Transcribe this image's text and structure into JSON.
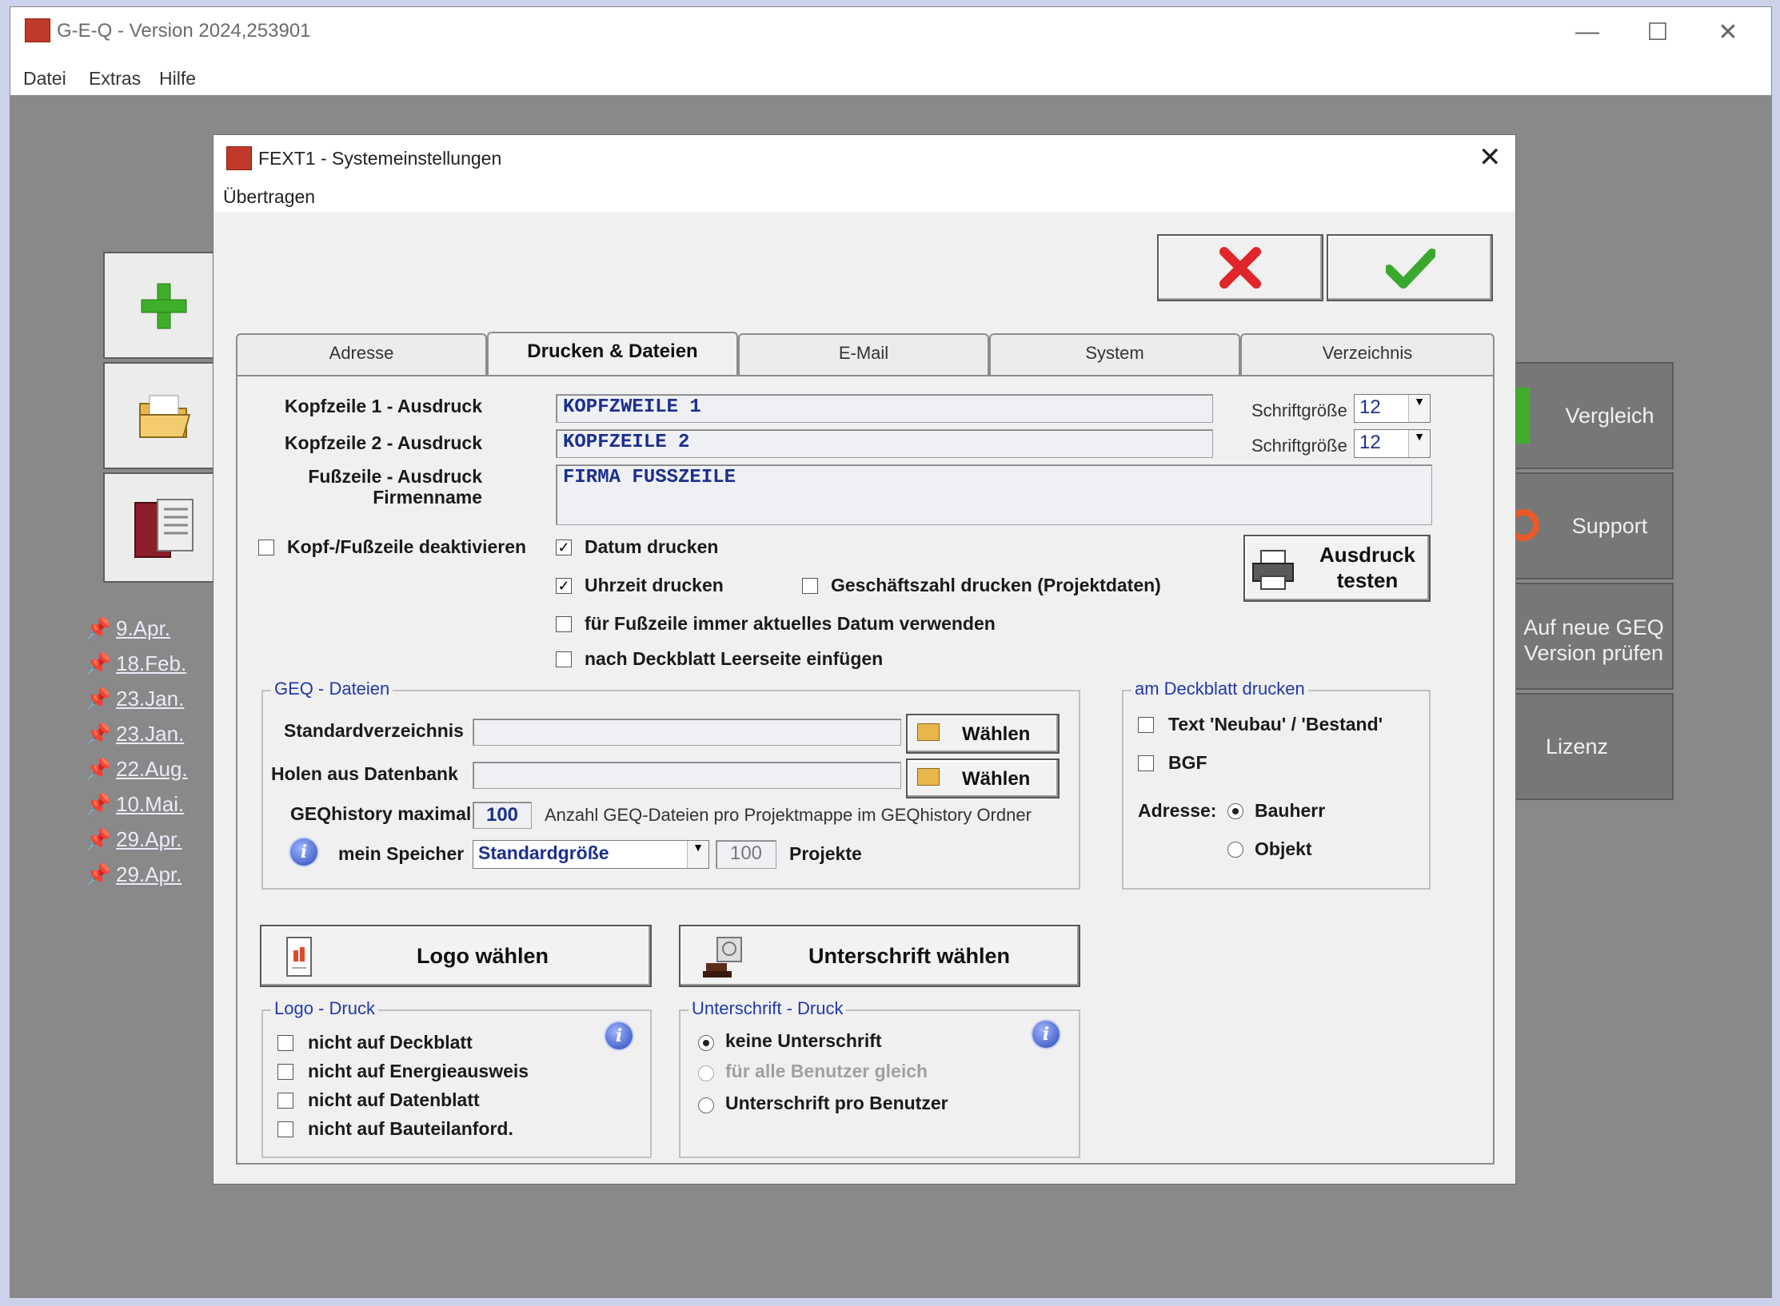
{
  "app": {
    "title": "G-E-Q - Version 2024,253901",
    "menu": [
      "Datei",
      "Extras",
      "Hilfe"
    ],
    "window_controls": [
      "minimize-icon",
      "maximize-icon",
      "close-icon"
    ]
  },
  "background": {
    "side_buttons": [
      "add-icon",
      "folder-icon",
      "book-icon"
    ],
    "recent": [
      "9.Apr.",
      "18.Feb.",
      "23.Jan.",
      "23.Jan.",
      "22.Aug.",
      "10.Mai.",
      "29.Apr.",
      "29.Apr."
    ],
    "right_buttons": [
      "Vergleich",
      "Support",
      "Auf neue GEQ Version prüfen",
      "Lizenz"
    ]
  },
  "dialog": {
    "title": "FEXT1 - Systemeinstellungen",
    "menu": "Übertragen",
    "tabs": [
      "Adresse",
      "Drucken & Dateien",
      "E-Mail",
      "System",
      "Verzeichnis"
    ],
    "active_tab": "Drucken & Dateien",
    "header": {
      "kopf1_label": "Kopfzeile 1 - Ausdruck",
      "kopf1_value": "KOPFZWEILE 1",
      "kopf2_label": "Kopfzeile 2 - Ausdruck",
      "kopf2_value": "KOPFZEILE 2",
      "fuss_label_1": "Fußzeile - Ausdruck",
      "fuss_label_2": "Firmenname",
      "fuss_value": "FIRMA FUSSZEILE",
      "size_label": "Schriftgröße",
      "size1": "12",
      "size2": "12"
    },
    "checks": {
      "deactivate": "Kopf-/Fußzeile deaktivieren",
      "datum": "Datum drucken",
      "uhrzeit": "Uhrzeit drucken",
      "geschaeftszahl": "Geschäftszahl drucken (Projektdaten)",
      "aktuelles_datum": "für Fußzeile immer aktuelles Datum verwenden",
      "leerseite": "nach Deckblatt Leerseite einfügen",
      "check_mark": "✓"
    },
    "print_test": {
      "line1": "Ausdruck",
      "line2": "testen"
    },
    "geq_files": {
      "title": "GEQ - Dateien",
      "std_label": "Standardverzeichnis",
      "holen_label": "Holen aus Datenbank",
      "choose": "Wählen",
      "history_label": "GEQhistory maximal",
      "history_value": "100",
      "history_desc": "Anzahl GEQ-Dateien pro Projektmappe im GEQhistory Ordner",
      "speicher_label": "mein Speicher",
      "speicher_value": "Standardgröße",
      "projects_value": "100",
      "projects_label": "Projekte"
    },
    "deckblatt": {
      "title": "am Deckblatt drucken",
      "text_neubau": "Text 'Neubau' / 'Bestand'",
      "bgf": "BGF",
      "adresse_label": "Adresse:",
      "bauherr": "Bauherr",
      "objekt": "Objekt"
    },
    "logo_button": "Logo wählen",
    "signature_button": "Unterschrift wählen",
    "logo_print": {
      "title": "Logo - Druck",
      "items": [
        "nicht auf Deckblatt",
        "nicht auf Energieausweis",
        "nicht auf Datenblatt",
        "nicht auf Bauteilanford."
      ]
    },
    "signature_print": {
      "title": "Unterschrift - Druck",
      "keine": "keine Unterschrift",
      "alle": "für alle Benutzer gleich",
      "pro": "Unterschrift pro Benutzer"
    },
    "info": "i",
    "colors": {
      "accent_blue": "#1c2f8f",
      "cancel_red": "#e0262a",
      "ok_green": "#3aa82e"
    }
  }
}
